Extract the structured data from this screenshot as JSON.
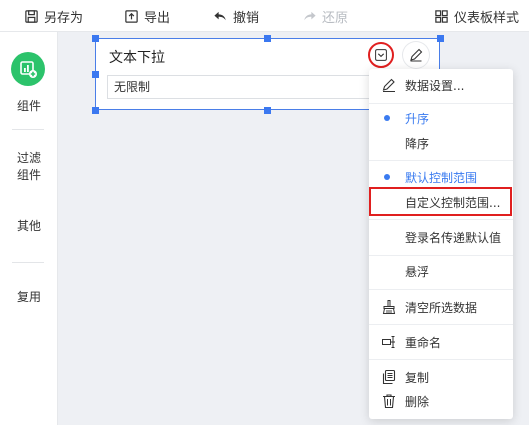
{
  "toolbar": {
    "save_as": "另存为",
    "export": "导出",
    "undo": "撤销",
    "redo": "还原",
    "dashboard_style": "仪表板样式"
  },
  "sidebar": {
    "components": "组件",
    "filter_line1": "过滤",
    "filter_line2": "组件",
    "other": "其他",
    "reuse": "复用"
  },
  "widget": {
    "title": "文本下拉",
    "select_value": "无限制"
  },
  "menu": {
    "data_settings": "数据设置...",
    "ascending": "升序",
    "descending": "降序",
    "default_range": "默认控制范围",
    "custom_range": "自定义控制范围...",
    "login_default": "登录名传递默认值",
    "float": "悬浮",
    "clear_selection": "清空所选数据",
    "rename": "重命名",
    "copy": "复制",
    "delete": "删除"
  },
  "colors": {
    "accent_blue": "#3a7bf0",
    "highlight_red": "#e01f1f",
    "logo_green": "#2cc36b"
  }
}
